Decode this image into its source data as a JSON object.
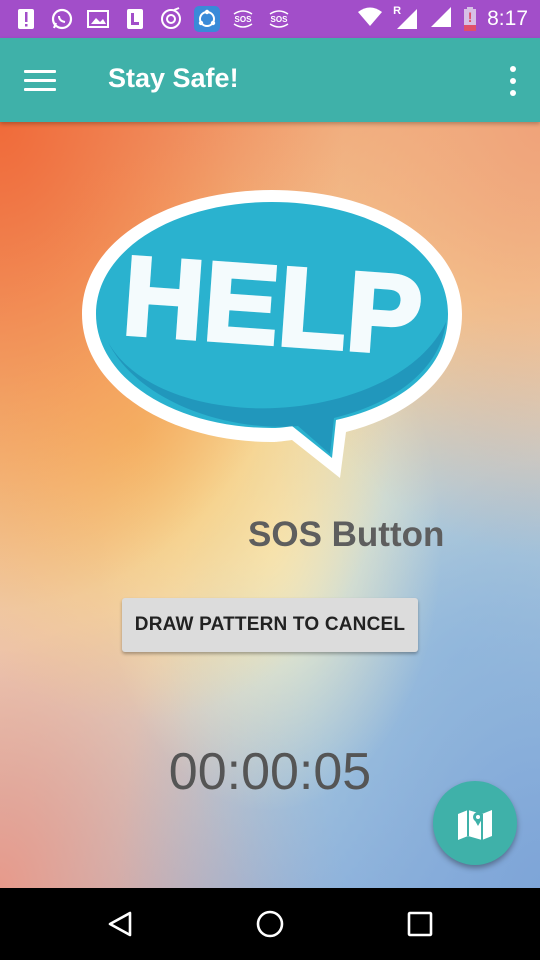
{
  "status_bar": {
    "time": "8:17",
    "notification_icons": [
      "alert-icon",
      "whatsapp-icon",
      "gallery-icon",
      "bookmark-icon",
      "music-icon",
      "shareit-icon",
      "sos-icon",
      "sos-icon"
    ],
    "sos_icon_text": "SOS",
    "signal_label": "R",
    "battery_alert": "!",
    "background": "#a24ec9"
  },
  "app_bar": {
    "title": "Stay Safe!",
    "background": "#3fb1a9"
  },
  "main": {
    "image_text": "HELP",
    "heading": "SOS Button",
    "cancel_button_label": "DRAW PATTERN TO CANCEL",
    "timer": "00:00:05"
  },
  "fab": {
    "icon": "map-icon",
    "color": "#3fb1a9"
  },
  "nav_bar": {
    "buttons": [
      "back-icon",
      "home-icon",
      "recents-icon"
    ]
  }
}
